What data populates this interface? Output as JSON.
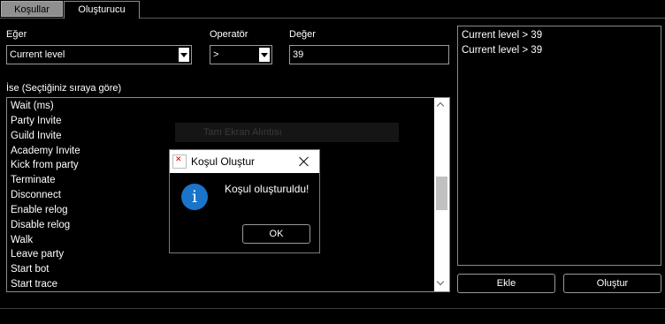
{
  "tabs": [
    {
      "label": "Koşullar",
      "active": false
    },
    {
      "label": "Oluşturucu",
      "active": true
    }
  ],
  "form": {
    "if_label": "Eğer",
    "if_value": "Current level",
    "operator_label": "Operatör",
    "operator_value": ">",
    "value_label": "Değer",
    "value_value": "39"
  },
  "then": {
    "label": "İse (Seçtiğiniz sıraya göre)",
    "items": [
      "Wait (ms)",
      "Party Invite",
      "Guild Invite",
      "Academy Invite",
      "Kick from party",
      "Terminate",
      "Disconnect",
      "Enable relog",
      "Disable relog",
      "Walk",
      "Leave party",
      "Start bot",
      "Start trace"
    ]
  },
  "conditions": {
    "items": [
      "Current level > 39",
      "Current level > 39"
    ]
  },
  "buttons": {
    "add": "Ekle",
    "create": "Oluştur"
  },
  "background_ghost": "Tam Ekran Alıntısı",
  "dialog": {
    "title": "Koşul Oluştur",
    "message": "Koşul oluşturuldu!",
    "ok": "OK"
  },
  "colors": {
    "background": "#000000",
    "info_icon": "#1a74c8",
    "inactive_tab": "#8f8f8f"
  }
}
